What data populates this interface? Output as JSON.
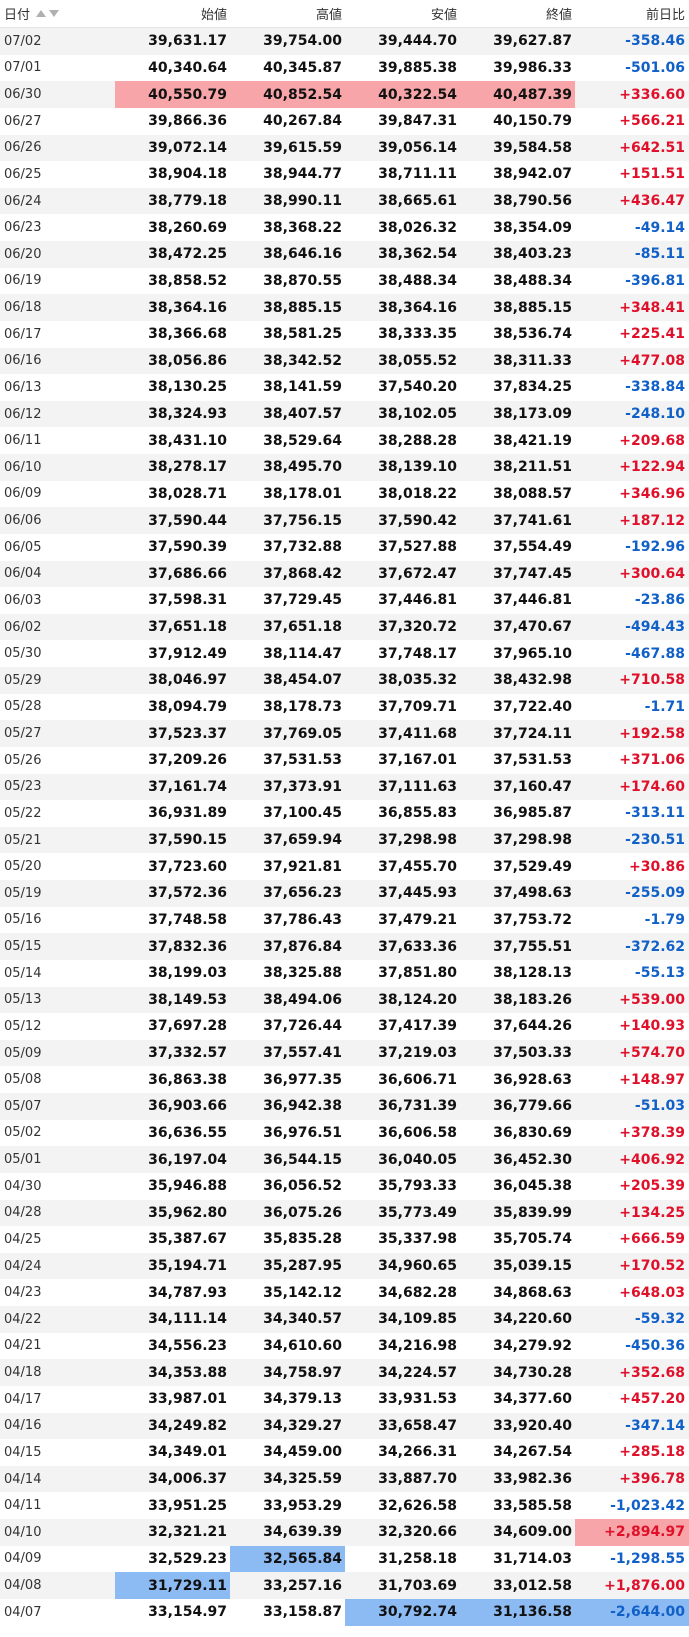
{
  "headers": {
    "date": "日付",
    "open": "始値",
    "high": "高値",
    "low": "安値",
    "close": "終値",
    "change": "前日比"
  },
  "colors": {
    "positive": "#e0102a",
    "negative": "#1060c8",
    "highlight_red": "#f7a5a8",
    "highlight_blue": "#8cbaf3"
  },
  "rows": [
    {
      "date": "07/02",
      "open": "39,631.17",
      "high": "39,754.00",
      "low": "39,444.70",
      "close": "39,627.87",
      "change": "-358.46"
    },
    {
      "date": "07/01",
      "open": "40,340.64",
      "high": "40,345.87",
      "low": "39,885.38",
      "close": "39,986.33",
      "change": "-501.06"
    },
    {
      "date": "06/30",
      "open": "40,550.79",
      "high": "40,852.54",
      "low": "40,322.54",
      "close": "40,487.39",
      "change": "+336.60",
      "hl": {
        "open": "red",
        "high": "red",
        "low": "red",
        "close": "red"
      }
    },
    {
      "date": "06/27",
      "open": "39,866.36",
      "high": "40,267.84",
      "low": "39,847.31",
      "close": "40,150.79",
      "change": "+566.21"
    },
    {
      "date": "06/26",
      "open": "39,072.14",
      "high": "39,615.59",
      "low": "39,056.14",
      "close": "39,584.58",
      "change": "+642.51"
    },
    {
      "date": "06/25",
      "open": "38,904.18",
      "high": "38,944.77",
      "low": "38,711.11",
      "close": "38,942.07",
      "change": "+151.51"
    },
    {
      "date": "06/24",
      "open": "38,779.18",
      "high": "38,990.11",
      "low": "38,665.61",
      "close": "38,790.56",
      "change": "+436.47"
    },
    {
      "date": "06/23",
      "open": "38,260.69",
      "high": "38,368.22",
      "low": "38,026.32",
      "close": "38,354.09",
      "change": "-49.14"
    },
    {
      "date": "06/20",
      "open": "38,472.25",
      "high": "38,646.16",
      "low": "38,362.54",
      "close": "38,403.23",
      "change": "-85.11"
    },
    {
      "date": "06/19",
      "open": "38,858.52",
      "high": "38,870.55",
      "low": "38,488.34",
      "close": "38,488.34",
      "change": "-396.81"
    },
    {
      "date": "06/18",
      "open": "38,364.16",
      "high": "38,885.15",
      "low": "38,364.16",
      "close": "38,885.15",
      "change": "+348.41"
    },
    {
      "date": "06/17",
      "open": "38,366.68",
      "high": "38,581.25",
      "low": "38,333.35",
      "close": "38,536.74",
      "change": "+225.41"
    },
    {
      "date": "06/16",
      "open": "38,056.86",
      "high": "38,342.52",
      "low": "38,055.52",
      "close": "38,311.33",
      "change": "+477.08"
    },
    {
      "date": "06/13",
      "open": "38,130.25",
      "high": "38,141.59",
      "low": "37,540.20",
      "close": "37,834.25",
      "change": "-338.84"
    },
    {
      "date": "06/12",
      "open": "38,324.93",
      "high": "38,407.57",
      "low": "38,102.05",
      "close": "38,173.09",
      "change": "-248.10"
    },
    {
      "date": "06/11",
      "open": "38,431.10",
      "high": "38,529.64",
      "low": "38,288.28",
      "close": "38,421.19",
      "change": "+209.68"
    },
    {
      "date": "06/10",
      "open": "38,278.17",
      "high": "38,495.70",
      "low": "38,139.10",
      "close": "38,211.51",
      "change": "+122.94"
    },
    {
      "date": "06/09",
      "open": "38,028.71",
      "high": "38,178.01",
      "low": "38,018.22",
      "close": "38,088.57",
      "change": "+346.96"
    },
    {
      "date": "06/06",
      "open": "37,590.44",
      "high": "37,756.15",
      "low": "37,590.42",
      "close": "37,741.61",
      "change": "+187.12"
    },
    {
      "date": "06/05",
      "open": "37,590.39",
      "high": "37,732.88",
      "low": "37,527.88",
      "close": "37,554.49",
      "change": "-192.96"
    },
    {
      "date": "06/04",
      "open": "37,686.66",
      "high": "37,868.42",
      "low": "37,672.47",
      "close": "37,747.45",
      "change": "+300.64"
    },
    {
      "date": "06/03",
      "open": "37,598.31",
      "high": "37,729.45",
      "low": "37,446.81",
      "close": "37,446.81",
      "change": "-23.86"
    },
    {
      "date": "06/02",
      "open": "37,651.18",
      "high": "37,651.18",
      "low": "37,320.72",
      "close": "37,470.67",
      "change": "-494.43"
    },
    {
      "date": "05/30",
      "open": "37,912.49",
      "high": "38,114.47",
      "low": "37,748.17",
      "close": "37,965.10",
      "change": "-467.88"
    },
    {
      "date": "05/29",
      "open": "38,046.97",
      "high": "38,454.07",
      "low": "38,035.32",
      "close": "38,432.98",
      "change": "+710.58"
    },
    {
      "date": "05/28",
      "open": "38,094.79",
      "high": "38,178.73",
      "low": "37,709.71",
      "close": "37,722.40",
      "change": "-1.71"
    },
    {
      "date": "05/27",
      "open": "37,523.37",
      "high": "37,769.05",
      "low": "37,411.68",
      "close": "37,724.11",
      "change": "+192.58"
    },
    {
      "date": "05/26",
      "open": "37,209.26",
      "high": "37,531.53",
      "low": "37,167.01",
      "close": "37,531.53",
      "change": "+371.06"
    },
    {
      "date": "05/23",
      "open": "37,161.74",
      "high": "37,373.91",
      "low": "37,111.63",
      "close": "37,160.47",
      "change": "+174.60"
    },
    {
      "date": "05/22",
      "open": "36,931.89",
      "high": "37,100.45",
      "low": "36,855.83",
      "close": "36,985.87",
      "change": "-313.11"
    },
    {
      "date": "05/21",
      "open": "37,590.15",
      "high": "37,659.94",
      "low": "37,298.98",
      "close": "37,298.98",
      "change": "-230.51"
    },
    {
      "date": "05/20",
      "open": "37,723.60",
      "high": "37,921.81",
      "low": "37,455.70",
      "close": "37,529.49",
      "change": "+30.86"
    },
    {
      "date": "05/19",
      "open": "37,572.36",
      "high": "37,656.23",
      "low": "37,445.93",
      "close": "37,498.63",
      "change": "-255.09"
    },
    {
      "date": "05/16",
      "open": "37,748.58",
      "high": "37,786.43",
      "low": "37,479.21",
      "close": "37,753.72",
      "change": "-1.79"
    },
    {
      "date": "05/15",
      "open": "37,832.36",
      "high": "37,876.84",
      "low": "37,633.36",
      "close": "37,755.51",
      "change": "-372.62"
    },
    {
      "date": "05/14",
      "open": "38,199.03",
      "high": "38,325.88",
      "low": "37,851.80",
      "close": "38,128.13",
      "change": "-55.13"
    },
    {
      "date": "05/13",
      "open": "38,149.53",
      "high": "38,494.06",
      "low": "38,124.20",
      "close": "38,183.26",
      "change": "+539.00"
    },
    {
      "date": "05/12",
      "open": "37,697.28",
      "high": "37,726.44",
      "low": "37,417.39",
      "close": "37,644.26",
      "change": "+140.93"
    },
    {
      "date": "05/09",
      "open": "37,332.57",
      "high": "37,557.41",
      "low": "37,219.03",
      "close": "37,503.33",
      "change": "+574.70"
    },
    {
      "date": "05/08",
      "open": "36,863.38",
      "high": "36,977.35",
      "low": "36,606.71",
      "close": "36,928.63",
      "change": "+148.97"
    },
    {
      "date": "05/07",
      "open": "36,903.66",
      "high": "36,942.38",
      "low": "36,731.39",
      "close": "36,779.66",
      "change": "-51.03"
    },
    {
      "date": "05/02",
      "open": "36,636.55",
      "high": "36,976.51",
      "low": "36,606.58",
      "close": "36,830.69",
      "change": "+378.39"
    },
    {
      "date": "05/01",
      "open": "36,197.04",
      "high": "36,544.15",
      "low": "36,040.05",
      "close": "36,452.30",
      "change": "+406.92"
    },
    {
      "date": "04/30",
      "open": "35,946.88",
      "high": "36,056.52",
      "low": "35,793.33",
      "close": "36,045.38",
      "change": "+205.39"
    },
    {
      "date": "04/28",
      "open": "35,962.80",
      "high": "36,075.26",
      "low": "35,773.49",
      "close": "35,839.99",
      "change": "+134.25"
    },
    {
      "date": "04/25",
      "open": "35,387.67",
      "high": "35,835.28",
      "low": "35,337.98",
      "close": "35,705.74",
      "change": "+666.59"
    },
    {
      "date": "04/24",
      "open": "35,194.71",
      "high": "35,287.95",
      "low": "34,960.65",
      "close": "35,039.15",
      "change": "+170.52"
    },
    {
      "date": "04/23",
      "open": "34,787.93",
      "high": "35,142.12",
      "low": "34,682.28",
      "close": "34,868.63",
      "change": "+648.03"
    },
    {
      "date": "04/22",
      "open": "34,111.14",
      "high": "34,340.57",
      "low": "34,109.85",
      "close": "34,220.60",
      "change": "-59.32"
    },
    {
      "date": "04/21",
      "open": "34,556.23",
      "high": "34,610.60",
      "low": "34,216.98",
      "close": "34,279.92",
      "change": "-450.36"
    },
    {
      "date": "04/18",
      "open": "34,353.88",
      "high": "34,758.97",
      "low": "34,224.57",
      "close": "34,730.28",
      "change": "+352.68"
    },
    {
      "date": "04/17",
      "open": "33,987.01",
      "high": "34,379.13",
      "low": "33,931.53",
      "close": "34,377.60",
      "change": "+457.20"
    },
    {
      "date": "04/16",
      "open": "34,249.82",
      "high": "34,329.27",
      "low": "33,658.47",
      "close": "33,920.40",
      "change": "-347.14"
    },
    {
      "date": "04/15",
      "open": "34,349.01",
      "high": "34,459.00",
      "low": "34,266.31",
      "close": "34,267.54",
      "change": "+285.18"
    },
    {
      "date": "04/14",
      "open": "34,006.37",
      "high": "34,325.59",
      "low": "33,887.70",
      "close": "33,982.36",
      "change": "+396.78"
    },
    {
      "date": "04/11",
      "open": "33,951.25",
      "high": "33,953.29",
      "low": "32,626.58",
      "close": "33,585.58",
      "change": "-1,023.42"
    },
    {
      "date": "04/10",
      "open": "32,321.21",
      "high": "34,639.39",
      "low": "32,320.66",
      "close": "34,609.00",
      "change": "+2,894.97",
      "hl": {
        "change": "red"
      }
    },
    {
      "date": "04/09",
      "open": "32,529.23",
      "high": "32,565.84",
      "low": "31,258.18",
      "close": "31,714.03",
      "change": "-1,298.55",
      "hl": {
        "high": "blue"
      }
    },
    {
      "date": "04/08",
      "open": "31,729.11",
      "high": "33,257.16",
      "low": "31,703.69",
      "close": "33,012.58",
      "change": "+1,876.00",
      "hl": {
        "open": "blue"
      }
    },
    {
      "date": "04/07",
      "open": "33,154.97",
      "high": "33,158.87",
      "low": "30,792.74",
      "close": "31,136.58",
      "change": "-2,644.00",
      "hl": {
        "low": "blue",
        "close": "blue",
        "change": "blue"
      }
    }
  ]
}
